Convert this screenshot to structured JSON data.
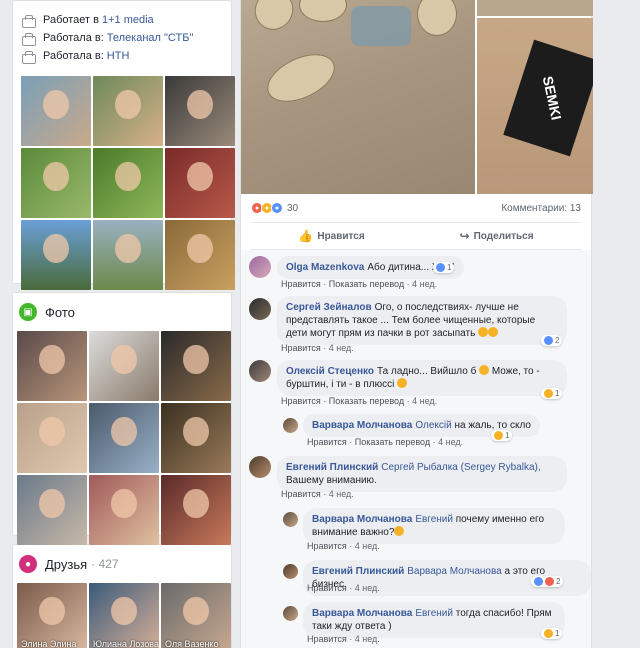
{
  "intro": {
    "jobs": [
      {
        "prefix": "Работает в",
        "place": "1+1 media"
      },
      {
        "prefix": "Работала в:",
        "place": "Телеканал \"СТБ\""
      },
      {
        "prefix": "Работала в:",
        "place": "НТН"
      }
    ]
  },
  "photos": {
    "title": "Фото"
  },
  "friends": {
    "title": "Друзья",
    "count": "427",
    "items": [
      "Элина Элина",
      "Юлиана Лозова",
      "Оля Вазенко"
    ]
  },
  "post": {
    "reaction_count": "30",
    "comments_count": "Комментарии: 13",
    "like_label": "Нравится",
    "share_label": "Поделиться"
  },
  "comments": [
    {
      "name": "Olga Mazenkova",
      "text": "Або дитина... Жах!",
      "reacts": "1"
    },
    {
      "name": "Сергей Зейналов",
      "text": "Ого, о последствиях- лучше не представлять такое ... Тем более чищенные, которые дети могут прям из пачки в рот засыпать",
      "meta_like": "Нравится",
      "meta_dot": " · ",
      "meta_translate": "Показать перевод",
      "meta_time": "4 нед.",
      "reacts": "2"
    },
    {
      "name": "Олексій Стеценко",
      "text": "Та ладно... Вийшло б",
      "text2": "Може, то - бурштин, і ти - в плюссі",
      "reacts": "1"
    },
    {
      "name": "Варвара Молчанова",
      "mention": "Олексій",
      "text": "на жаль, то скло",
      "reacts": "1"
    },
    {
      "name": "Евгений Плинский",
      "mention": "Сергей Рыбалка (Sergey Rybalka),",
      "text": "Вашему вниманию."
    },
    {
      "name": "Варвара Молчанова",
      "mention": "Евгений",
      "text": "почему именно его внимание важно?"
    },
    {
      "name": "Евгений Плинский",
      "mention": "Варвара Молчанова",
      "text": "а это его бизнес.",
      "reacts": "2"
    },
    {
      "name": "Варвара Молчанова",
      "mention": "Евгений",
      "text": "тогда спасибо! Прям таки жду ответа )",
      "reacts": "1"
    }
  ],
  "meta": {
    "like": "Нравится",
    "translate": "Показать перевод",
    "time": "4 нед.",
    "dot": "·"
  },
  "colors": {
    "link": "#365899",
    "bg": "#e9ebee",
    "photos_badge": "#42b72a",
    "friends_badge": "#d02f7b"
  }
}
